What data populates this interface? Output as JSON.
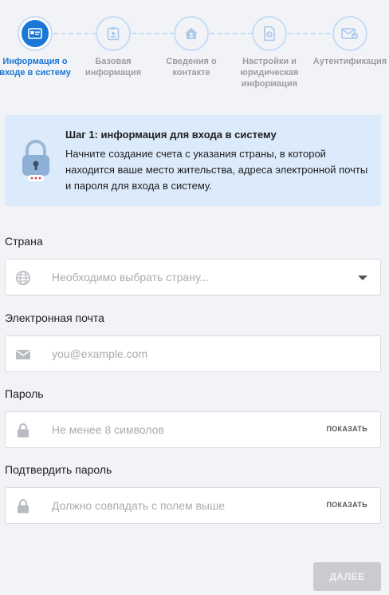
{
  "steps": [
    {
      "label": "Информация о входе в систему",
      "active": true,
      "icon": "id-card-icon"
    },
    {
      "label": "Базовая информация",
      "active": false,
      "icon": "badge-icon"
    },
    {
      "label": "Сведения о контакте",
      "active": false,
      "icon": "home-contact-icon"
    },
    {
      "label": "Настройки и юридическая информация",
      "active": false,
      "icon": "settings-doc-icon"
    },
    {
      "label": "Аутентификация",
      "active": false,
      "icon": "mail-verify-icon"
    }
  ],
  "info": {
    "title": "Шаг 1: информация для входа в систему",
    "description": "Начните создание счета с указания страны, в которой находится ваше место жительства, адреса электронной почты и пароля для входа в систему.",
    "icon": "padlock-icon"
  },
  "form": {
    "country": {
      "label": "Страна",
      "placeholder": "Необходимо выбрать страну...",
      "icon": "globe-icon"
    },
    "email": {
      "label": "Электронная почта",
      "placeholder": "you@example.com",
      "icon": "envelope-icon"
    },
    "password": {
      "label": "Пароль",
      "placeholder": "Не менее 8 символов",
      "show_label": "ПОКАЗАТЬ",
      "icon": "lock-icon"
    },
    "confirm": {
      "label": "Подтвердить пароль",
      "placeholder": "Должно совпадать с полем выше",
      "show_label": "ПОКАЗАТЬ",
      "icon": "lock-icon"
    }
  },
  "next_label": "ДАЛЕЕ",
  "colors": {
    "accent": "#1b77d6",
    "info_bg": "#dcebfb",
    "disabled": "#c9cbd0"
  }
}
